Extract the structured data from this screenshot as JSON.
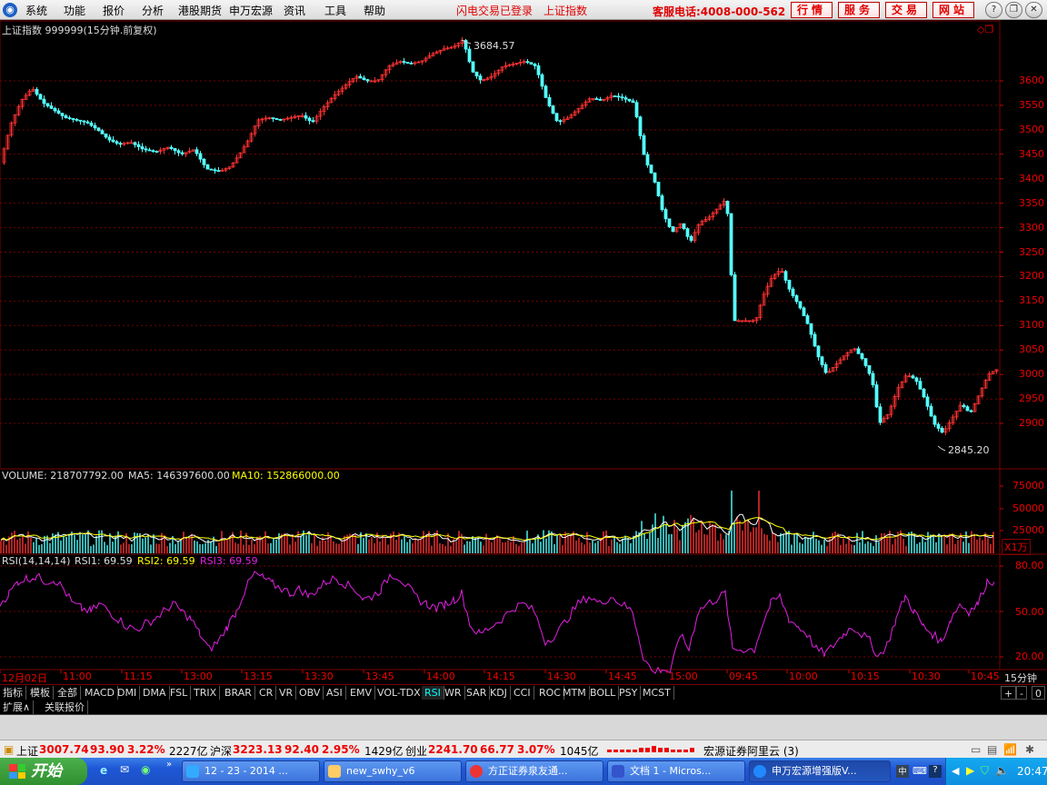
{
  "menubar": {
    "items": [
      "系统",
      "功能",
      "报价",
      "分析",
      "港股期货",
      "申万宏源",
      "资讯",
      "工具",
      "帮助"
    ],
    "status": [
      "闪电交易已登录",
      "上证指数"
    ],
    "hotline": "客服电话:4008-000-562",
    "buttons": [
      "行情",
      "服务",
      "交易",
      "网站"
    ]
  },
  "price_chart": {
    "title": "上证指数 999999(15分钟.前复权)",
    "high_label": "3684.57",
    "low_label": "2845.20",
    "y_ticks": [
      "3600",
      "3550",
      "3500",
      "3450",
      "3400",
      "3350",
      "3300",
      "3250",
      "3200",
      "3150",
      "3100",
      "3050",
      "3000",
      "2950",
      "2900"
    ]
  },
  "volume_panel": {
    "label": "VOLUME: 218707792.00",
    "ma5": "MA5: 146397600.00",
    "ma10": "MA10: 152866000.00",
    "y_ticks": [
      "75000",
      "50000",
      "25000"
    ],
    "unit": "X1万"
  },
  "rsi_panel": {
    "label": "RSI(14,14,14)",
    "rsi1": "RSI1: 69.59",
    "rsi2": "RSI2: 69.59",
    "rsi3": "RSI3: 69.59",
    "y_ticks": [
      "80.00",
      "50.00",
      "20.00"
    ]
  },
  "time_axis": {
    "labels": [
      "12月02日",
      "11:00",
      "11:15",
      "13:00",
      "13:15",
      "13:30",
      "13:45",
      "14:00",
      "14:15",
      "14:30",
      "14:45",
      "15:00",
      "09:45",
      "10:00",
      "10:15",
      "10:30",
      "10:45"
    ],
    "period": "15分钟"
  },
  "indicator_tabs": [
    "指标",
    "模板",
    "全部",
    "MACD",
    "DMI",
    "DMA",
    "FSL",
    "TRIX",
    "BRAR",
    "CR",
    "VR",
    "OBV",
    "ASI",
    "EMV",
    "VOL-TDX",
    "RSI",
    "WR",
    "SAR",
    "KDJ",
    "CCI",
    "ROC",
    "MTM",
    "BOLL",
    "PSY",
    "MCST"
  ],
  "tab_controls": [
    "+",
    "-",
    "0"
  ],
  "ext_row": [
    "扩展∧",
    "关联报价"
  ],
  "statusbar": {
    "sh_name": "上证",
    "sh_value": "3007.74",
    "sh_change": "93.90",
    "sh_pct": "3.22%",
    "sh_amount": "2227亿",
    "hs_name": "沪深",
    "hs_value": "3223.13",
    "hs_change": "92.40",
    "hs_pct": "2.95%",
    "hs_amount": "1429亿",
    "cy_name": "创业",
    "cy_value": "2241.70",
    "cy_change": "66.77",
    "cy_pct": "3.07%",
    "cy_amount": "1045亿",
    "broker": "宏源证券阿里云 (3)"
  },
  "taskbar": {
    "start": "开始",
    "tasks": [
      "12 - 23 - 2014 ...",
      "new_swhy_v6",
      "方正证券泉友通...",
      "文档 1 - Micros...",
      "申万宏源增强版V..."
    ],
    "clock": "20:47"
  },
  "chart_data": [
    {
      "type": "candlestick",
      "title": "上证指数 999999(15分钟.前复权)",
      "ylim": [
        2845.2,
        3684.57
      ],
      "y_ticks": [
        2900,
        2950,
        3000,
        3050,
        3100,
        3150,
        3200,
        3250,
        3300,
        3350,
        3400,
        3450,
        3500,
        3550,
        3600
      ],
      "annotations": [
        {
          "label": "3684.57",
          "kind": "high"
        },
        {
          "label": "2845.20",
          "kind": "low"
        }
      ],
      "close_path_approx": [
        [
          0,
          3440
        ],
        [
          10,
          3510
        ],
        [
          22,
          3560
        ],
        [
          34,
          3585
        ],
        [
          46,
          3555
        ],
        [
          58,
          3540
        ],
        [
          70,
          3525
        ],
        [
          82,
          3520
        ],
        [
          94,
          3515
        ],
        [
          106,
          3500
        ],
        [
          118,
          3480
        ],
        [
          130,
          3470
        ],
        [
          142,
          3475
        ],
        [
          156,
          3460
        ],
        [
          170,
          3455
        ],
        [
          184,
          3465
        ],
        [
          198,
          3450
        ],
        [
          212,
          3460
        ],
        [
          226,
          3420
        ],
        [
          240,
          3415
        ],
        [
          252,
          3425
        ],
        [
          262,
          3450
        ],
        [
          272,
          3480
        ],
        [
          282,
          3520
        ],
        [
          294,
          3525
        ],
        [
          306,
          3520
        ],
        [
          318,
          3525
        ],
        [
          330,
          3530
        ],
        [
          342,
          3515
        ],
        [
          354,
          3545
        ],
        [
          366,
          3570
        ],
        [
          378,
          3590
        ],
        [
          390,
          3610
        ],
        [
          402,
          3600
        ],
        [
          414,
          3600
        ],
        [
          426,
          3630
        ],
        [
          438,
          3640
        ],
        [
          450,
          3635
        ],
        [
          462,
          3640
        ],
        [
          474,
          3655
        ],
        [
          486,
          3665
        ],
        [
          498,
          3670
        ],
        [
          508,
          3684
        ],
        [
          518,
          3620
        ],
        [
          528,
          3600
        ],
        [
          540,
          3610
        ],
        [
          552,
          3630
        ],
        [
          564,
          3635
        ],
        [
          576,
          3640
        ],
        [
          588,
          3630
        ],
        [
          600,
          3560
        ],
        [
          612,
          3515
        ],
        [
          624,
          3525
        ],
        [
          636,
          3545
        ],
        [
          648,
          3565
        ],
        [
          660,
          3560
        ],
        [
          672,
          3570
        ],
        [
          684,
          3565
        ],
        [
          696,
          3555
        ],
        [
          708,
          3440
        ],
        [
          718,
          3400
        ],
        [
          728,
          3330
        ],
        [
          738,
          3290
        ],
        [
          748,
          3310
        ],
        [
          758,
          3270
        ],
        [
          768,
          3310
        ],
        [
          778,
          3320
        ],
        [
          788,
          3340
        ],
        [
          798,
          3360
        ],
        [
          806,
          3110
        ],
        [
          830,
          3110
        ],
        [
          838,
          3160
        ],
        [
          848,
          3200
        ],
        [
          858,
          3215
        ],
        [
          868,
          3170
        ],
        [
          878,
          3140
        ],
        [
          888,
          3100
        ],
        [
          898,
          3040
        ],
        [
          908,
          3000
        ],
        [
          918,
          3020
        ],
        [
          928,
          3040
        ],
        [
          938,
          3055
        ],
        [
          948,
          3030
        ],
        [
          958,
          2990
        ],
        [
          966,
          2900
        ],
        [
          976,
          2920
        ],
        [
          986,
          2970
        ],
        [
          996,
          3000
        ],
        [
          1006,
          2990
        ],
        [
          1016,
          2950
        ],
        [
          1026,
          2900
        ],
        [
          1036,
          2880
        ],
        [
          1046,
          2910
        ],
        [
          1056,
          2940
        ],
        [
          1066,
          2920
        ],
        [
          1076,
          2960
        ],
        [
          1086,
          3000
        ],
        [
          1094,
          3010
        ]
      ]
    },
    {
      "type": "bar",
      "title": "VOLUME",
      "ylabel": "X1万",
      "y_ticks": [
        25000,
        50000,
        75000
      ],
      "series": [
        {
          "name": "VOLUME"
        },
        {
          "name": "MA5"
        },
        {
          "name": "MA10"
        }
      ]
    },
    {
      "type": "line",
      "title": "RSI(14,14,14)",
      "ylim": [
        20,
        80
      ],
      "y_ticks": [
        20,
        50,
        80
      ],
      "series": [
        {
          "name": "RSI1",
          "last": 69.59
        },
        {
          "name": "RSI2",
          "last": 69.59
        },
        {
          "name": "RSI3",
          "last": 69.59
        }
      ],
      "approx_path": [
        [
          0,
          55
        ],
        [
          10,
          62
        ],
        [
          20,
          70
        ],
        [
          30,
          72
        ],
        [
          40,
          73
        ],
        [
          50,
          70
        ],
        [
          60,
          71
        ],
        [
          70,
          65
        ],
        [
          80,
          55
        ],
        [
          90,
          52
        ],
        [
          100,
          50
        ],
        [
          110,
          55
        ],
        [
          120,
          50
        ],
        [
          130,
          45
        ],
        [
          140,
          40
        ],
        [
          150,
          38
        ],
        [
          160,
          42
        ],
        [
          170,
          45
        ],
        [
          180,
          50
        ],
        [
          190,
          55
        ],
        [
          200,
          50
        ],
        [
          210,
          45
        ],
        [
          220,
          35
        ],
        [
          230,
          25
        ],
        [
          240,
          30
        ],
        [
          250,
          40
        ],
        [
          260,
          50
        ],
        [
          270,
          65
        ],
        [
          280,
          75
        ],
        [
          290,
          72
        ],
        [
          300,
          68
        ],
        [
          310,
          65
        ],
        [
          320,
          62
        ],
        [
          330,
          65
        ],
        [
          340,
          60
        ],
        [
          350,
          65
        ],
        [
          360,
          70
        ],
        [
          370,
          72
        ],
        [
          380,
          68
        ],
        [
          390,
          65
        ],
        [
          400,
          58
        ],
        [
          410,
          60
        ],
        [
          420,
          65
        ],
        [
          430,
          75
        ],
        [
          440,
          72
        ],
        [
          450,
          65
        ],
        [
          460,
          58
        ],
        [
          470,
          55
        ],
        [
          480,
          52
        ],
        [
          490,
          55
        ],
        [
          500,
          58
        ],
        [
          508,
          62
        ],
        [
          518,
          40
        ],
        [
          528,
          35
        ],
        [
          540,
          40
        ],
        [
          552,
          45
        ],
        [
          564,
          52
        ],
        [
          576,
          55
        ],
        [
          588,
          50
        ],
        [
          600,
          30
        ],
        [
          612,
          35
        ],
        [
          624,
          45
        ],
        [
          636,
          55
        ],
        [
          648,
          60
        ],
        [
          660,
          55
        ],
        [
          672,
          60
        ],
        [
          684,
          55
        ],
        [
          696,
          50
        ],
        [
          708,
          20
        ],
        [
          718,
          10
        ],
        [
          728,
          12
        ],
        [
          738,
          10
        ],
        [
          748,
          35
        ],
        [
          758,
          25
        ],
        [
          768,
          50
        ],
        [
          778,
          55
        ],
        [
          788,
          58
        ],
        [
          798,
          62
        ],
        [
          806,
          25
        ],
        [
          830,
          25
        ],
        [
          838,
          40
        ],
        [
          848,
          55
        ],
        [
          858,
          60
        ],
        [
          868,
          45
        ],
        [
          878,
          40
        ],
        [
          888,
          35
        ],
        [
          898,
          25
        ],
        [
          908,
          22
        ],
        [
          918,
          28
        ],
        [
          928,
          35
        ],
        [
          938,
          40
        ],
        [
          948,
          35
        ],
        [
          958,
          30
        ],
        [
          966,
          20
        ],
        [
          976,
          28
        ],
        [
          986,
          45
        ],
        [
          996,
          60
        ],
        [
          1006,
          50
        ],
        [
          1016,
          40
        ],
        [
          1026,
          35
        ],
        [
          1036,
          30
        ],
        [
          1046,
          45
        ],
        [
          1056,
          55
        ],
        [
          1066,
          50
        ],
        [
          1076,
          55
        ],
        [
          1086,
          70
        ],
        [
          1094,
          69.59
        ]
      ]
    }
  ]
}
